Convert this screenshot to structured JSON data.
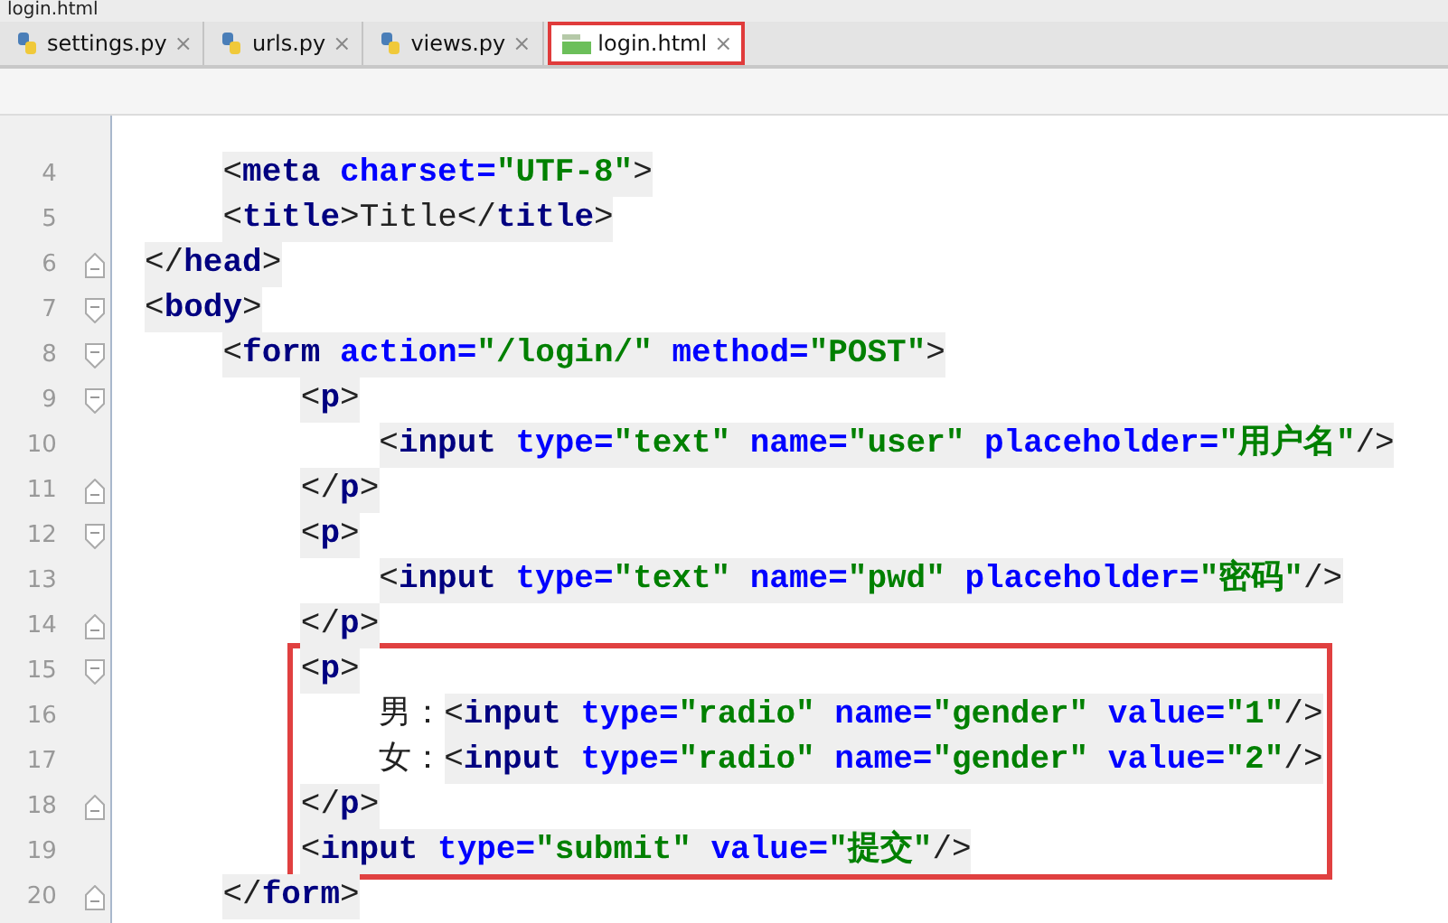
{
  "breadcrumb": "login.html",
  "tabs": [
    {
      "label": "settings.py",
      "close": "×",
      "kind": "python",
      "selected": false,
      "highlighted": false
    },
    {
      "label": "urls.py",
      "close": "×",
      "kind": "python",
      "selected": false,
      "highlighted": false
    },
    {
      "label": "views.py",
      "close": "×",
      "kind": "python",
      "selected": false,
      "highlighted": false
    },
    {
      "label": "login.html",
      "close": "×",
      "kind": "html",
      "selected": true,
      "highlighted": true
    }
  ],
  "lines": [
    {
      "number": "4",
      "kind": "plain",
      "boxed": false,
      "tokens": [
        {
          "kind": "punct",
          "text": "    <"
        },
        {
          "kind": "tag",
          "text": "meta"
        },
        {
          "kind": "attr",
          "text": " charset="
        },
        {
          "kind": "str",
          "text": "\"UTF-8\""
        },
        {
          "kind": "punct",
          "text": ">"
        }
      ]
    },
    {
      "number": "5",
      "kind": "plain",
      "boxed": false,
      "tokens": [
        {
          "kind": "punct",
          "text": "    <"
        },
        {
          "kind": "tag",
          "text": "title"
        },
        {
          "kind": "punct",
          "text": ">"
        },
        {
          "kind": "text",
          "text": "Title"
        },
        {
          "kind": "punct",
          "text": "</"
        },
        {
          "kind": "tag",
          "text": "title"
        },
        {
          "kind": "punct",
          "text": ">"
        }
      ]
    },
    {
      "number": "6",
      "kind": "fold-close",
      "boxed": false,
      "tokens": [
        {
          "kind": "punct",
          "text": "</"
        },
        {
          "kind": "tag",
          "text": "head"
        },
        {
          "kind": "punct",
          "text": ">"
        }
      ]
    },
    {
      "number": "7",
      "kind": "fold-open",
      "boxed": false,
      "tokens": [
        {
          "kind": "punct",
          "text": "<"
        },
        {
          "kind": "tag",
          "text": "body"
        },
        {
          "kind": "punct",
          "text": ">"
        }
      ]
    },
    {
      "number": "8",
      "kind": "fold-open",
      "boxed": false,
      "tokens": [
        {
          "kind": "punct",
          "text": "    <"
        },
        {
          "kind": "tag",
          "text": "form"
        },
        {
          "kind": "attr",
          "text": " action="
        },
        {
          "kind": "str",
          "text": "\"/login/\""
        },
        {
          "kind": "attr",
          "text": " method="
        },
        {
          "kind": "str",
          "text": "\"POST\""
        },
        {
          "kind": "punct",
          "text": ">"
        }
      ]
    },
    {
      "number": "9",
      "kind": "fold-open",
      "boxed": false,
      "tokens": [
        {
          "kind": "punct",
          "text": "        <"
        },
        {
          "kind": "tag",
          "text": "p"
        },
        {
          "kind": "punct",
          "text": ">"
        }
      ]
    },
    {
      "number": "10",
      "kind": "plain",
      "boxed": false,
      "tokens": [
        {
          "kind": "punct",
          "text": "            <"
        },
        {
          "kind": "tag",
          "text": "input"
        },
        {
          "kind": "attr",
          "text": " type="
        },
        {
          "kind": "str",
          "text": "\"text\""
        },
        {
          "kind": "attr",
          "text": " name="
        },
        {
          "kind": "str",
          "text": "\"user\""
        },
        {
          "kind": "attr",
          "text": " placeholder="
        },
        {
          "kind": "str",
          "text": "\"用户名\""
        },
        {
          "kind": "punct",
          "text": "/>"
        }
      ]
    },
    {
      "number": "11",
      "kind": "fold-close",
      "boxed": false,
      "tokens": [
        {
          "kind": "punct",
          "text": "        </"
        },
        {
          "kind": "tag",
          "text": "p"
        },
        {
          "kind": "punct",
          "text": ">"
        }
      ]
    },
    {
      "number": "12",
      "kind": "fold-open",
      "boxed": false,
      "tokens": [
        {
          "kind": "punct",
          "text": "        <"
        },
        {
          "kind": "tag",
          "text": "p"
        },
        {
          "kind": "punct",
          "text": ">"
        }
      ]
    },
    {
      "number": "13",
      "kind": "plain",
      "boxed": false,
      "tokens": [
        {
          "kind": "punct",
          "text": "            <"
        },
        {
          "kind": "tag",
          "text": "input"
        },
        {
          "kind": "attr",
          "text": " type="
        },
        {
          "kind": "str",
          "text": "\"text\""
        },
        {
          "kind": "attr",
          "text": " name="
        },
        {
          "kind": "str",
          "text": "\"pwd\""
        },
        {
          "kind": "attr",
          "text": " placeholder="
        },
        {
          "kind": "str",
          "text": "\"密码\""
        },
        {
          "kind": "punct",
          "text": "/>"
        }
      ]
    },
    {
      "number": "14",
      "kind": "fold-close",
      "boxed": false,
      "tokens": [
        {
          "kind": "punct",
          "text": "        </"
        },
        {
          "kind": "tag",
          "text": "p"
        },
        {
          "kind": "punct",
          "text": ">"
        }
      ]
    },
    {
      "number": "15",
      "kind": "fold-open",
      "boxed": true,
      "tokens": [
        {
          "kind": "punct",
          "text": "        <"
        },
        {
          "kind": "tag",
          "text": "p"
        },
        {
          "kind": "punct",
          "text": ">"
        }
      ]
    },
    {
      "number": "16",
      "kind": "plain",
      "boxed": true,
      "tokens": [
        {
          "kind": "plain",
          "text": "            男："
        },
        {
          "kind": "punct",
          "text": "<"
        },
        {
          "kind": "tag",
          "text": "input"
        },
        {
          "kind": "attr",
          "text": " type="
        },
        {
          "kind": "str",
          "text": "\"radio\""
        },
        {
          "kind": "attr",
          "text": " name="
        },
        {
          "kind": "str",
          "text": "\"gender\""
        },
        {
          "kind": "attr",
          "text": " value="
        },
        {
          "kind": "str",
          "text": "\"1\""
        },
        {
          "kind": "punct",
          "text": "/>"
        }
      ]
    },
    {
      "number": "17",
      "kind": "plain",
      "boxed": true,
      "tokens": [
        {
          "kind": "plain",
          "text": "            女："
        },
        {
          "kind": "punct",
          "text": "<"
        },
        {
          "kind": "tag",
          "text": "input"
        },
        {
          "kind": "attr",
          "text": " type="
        },
        {
          "kind": "str",
          "text": "\"radio\""
        },
        {
          "kind": "attr",
          "text": " name="
        },
        {
          "kind": "str",
          "text": "\"gender\""
        },
        {
          "kind": "attr",
          "text": " value="
        },
        {
          "kind": "str",
          "text": "\"2\""
        },
        {
          "kind": "punct",
          "text": "/>"
        }
      ]
    },
    {
      "number": "18",
      "kind": "fold-close",
      "boxed": true,
      "tokens": [
        {
          "kind": "punct",
          "text": "        </"
        },
        {
          "kind": "tag",
          "text": "p"
        },
        {
          "kind": "punct",
          "text": ">"
        }
      ]
    },
    {
      "number": "19",
      "kind": "plain",
      "boxed": true,
      "tokens": [
        {
          "kind": "punct",
          "text": "        <"
        },
        {
          "kind": "tag",
          "text": "input"
        },
        {
          "kind": "attr",
          "text": " type="
        },
        {
          "kind": "str",
          "text": "\"submit\""
        },
        {
          "kind": "attr",
          "text": " value="
        },
        {
          "kind": "str",
          "text": "\"提交\""
        },
        {
          "kind": "punct",
          "text": "/>"
        }
      ]
    },
    {
      "number": "20",
      "kind": "fold-close",
      "boxed": false,
      "tokens": [
        {
          "kind": "punct",
          "text": "    </"
        },
        {
          "kind": "tag",
          "text": "form"
        },
        {
          "kind": "punct",
          "text": ">"
        }
      ]
    }
  ]
}
